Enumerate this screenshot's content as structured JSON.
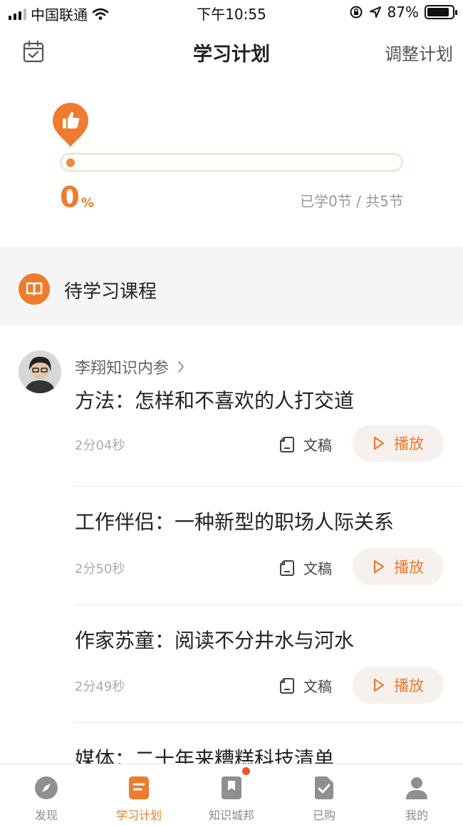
{
  "status_bar": {
    "carrier": "中国联通",
    "time": "下午10:55",
    "battery": "87%",
    "battery_level": 0.87
  },
  "nav": {
    "title": "学习计划",
    "adjust": "调整计划",
    "calendar_icon": "calendar-check-icon"
  },
  "progress": {
    "percent": "0",
    "percent_symbol": "%",
    "percent_value": 0,
    "learned_text": "已学0节 / 共5节",
    "pin_icon": "thumbs-up-icon"
  },
  "pending": {
    "label": "待学习课程",
    "icon": "open-book-icon"
  },
  "lessons": [
    {
      "source": "李翔知识内参",
      "title": "方法：怎样和不喜欢的人打交道",
      "duration": "2分04秒",
      "doc_label": "文稿",
      "play_label": "播放"
    },
    {
      "title": "工作伴侣：一种新型的职场人际关系",
      "duration": "2分50秒",
      "doc_label": "文稿",
      "play_label": "播放"
    },
    {
      "title": "作家苏童：阅读不分井水与河水",
      "duration": "2分49秒",
      "doc_label": "文稿",
      "play_label": "播放"
    },
    {
      "title": "媒体：二十年来糟糕科技清单"
    }
  ],
  "tabs": [
    {
      "label": "发现",
      "icon": "compass-icon",
      "active": false
    },
    {
      "label": "学习计划",
      "icon": "study-plan-icon",
      "active": true
    },
    {
      "label": "知识城邦",
      "icon": "bookmark-icon",
      "active": false,
      "badge": true
    },
    {
      "label": "已购",
      "icon": "purchased-icon",
      "active": false
    },
    {
      "label": "我的",
      "icon": "profile-icon",
      "active": false
    }
  ],
  "colors": {
    "accent": "#ee7b2e",
    "track_border": "#f3e6d4",
    "section_bg": "#f5f5f5",
    "play_bg": "#f6f1ed",
    "badge_red": "#e8552c"
  }
}
